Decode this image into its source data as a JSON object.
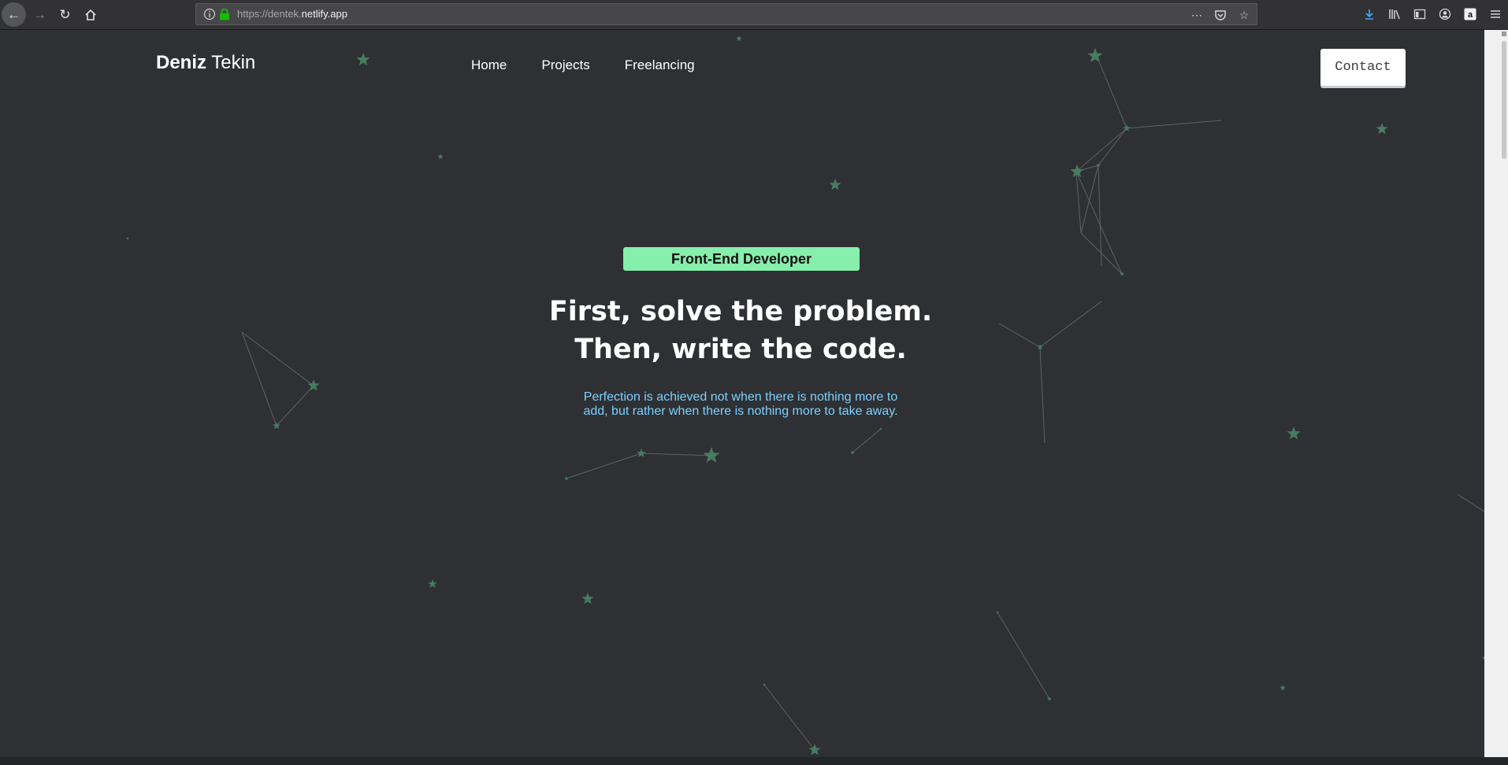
{
  "browser": {
    "url_prefix": "https://dentek.",
    "url_host": "netlify.app",
    "icons": [
      "back-icon",
      "forward-icon",
      "reload-icon",
      "home-icon",
      "info-icon",
      "lock-icon",
      "more-icon",
      "pocket-icon",
      "bookmark-star-icon",
      "download-icon",
      "library-icon",
      "sidebar-icon",
      "account-icon",
      "amazon-icon",
      "menu-icon"
    ]
  },
  "site": {
    "brand_first": "Deniz",
    "brand_last": " Tekin",
    "nav": [
      "Home",
      "Projects",
      "Freelancing"
    ],
    "contact_label": "Contact"
  },
  "hero": {
    "role": "Front-End Developer",
    "headline_line1": "First, solve the problem.",
    "headline_line2": "Then, write the code.",
    "quote": "Perfection is achieved not when there is nothing more to add, but rather when there is nothing more to take away."
  },
  "colors": {
    "background": "#2e3033",
    "accent_green": "#86efac",
    "quote_blue": "#7fd0ff",
    "star": "#3f7a5c"
  }
}
